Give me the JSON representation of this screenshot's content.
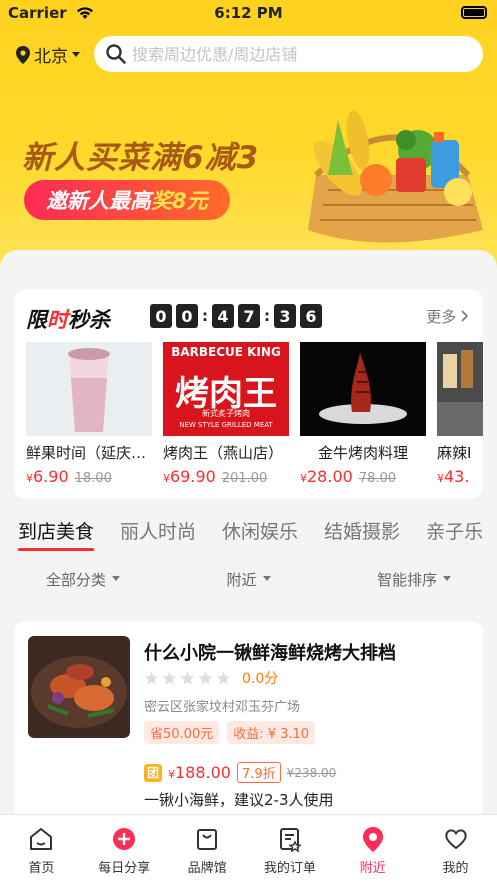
{
  "status_bar": {
    "carrier": "Carrier",
    "time": "6:12 PM"
  },
  "header": {
    "city": "北京",
    "search_placeholder": "搜索周边优惠/周边店铺"
  },
  "banner": {
    "headline": "新人买菜满6减3",
    "pill_prefix": "邀新人最高",
    "pill_highlight": "奖8元"
  },
  "flash_sale": {
    "title_left": "限",
    "title_red": "时",
    "title_right": "秒杀",
    "countdown": [
      "0",
      "0",
      "4",
      "7",
      "3",
      "6"
    ],
    "more_label": "更多",
    "products": [
      {
        "name": "鲜果时间（延庆…",
        "currency": "¥",
        "price": "6.90",
        "old_price": "18.00"
      },
      {
        "name": "烤肉王（燕山店）",
        "currency": "¥",
        "price": "69.90",
        "old_price": "201.00",
        "sign_top": "BARBECUE KING",
        "sign_main": "烤肉王",
        "sign_sub": "新式炙子烤肉",
        "sign_en": "NEW STYLE GRILLED MEAT"
      },
      {
        "name": "金牛烤肉料理",
        "currency": "¥",
        "price": "28.00",
        "old_price": "78.00"
      },
      {
        "name": "麻辣I",
        "currency": "¥",
        "price": "43.",
        "old_price": ""
      }
    ]
  },
  "category_tabs": [
    "到店美食",
    "丽人时尚",
    "休闲娱乐",
    "结婚摄影",
    "亲子乐"
  ],
  "filters": [
    "全部分类",
    "附近",
    "智能排序"
  ],
  "store": {
    "name": "什么小院一锹鲜海鲜烧烤大排档",
    "score": "0.0分",
    "address": "密云区张家坟村邓玉芬广场",
    "tag_save": "省50.00元",
    "tag_income": "收益: ¥ 3.10",
    "deal_badge": "团",
    "deal_currency": "¥",
    "deal_price": "188.00",
    "deal_discount": "7.9折",
    "deal_old": "¥238.00",
    "deal_desc": "一锹小海鲜，建议2-3人使用"
  },
  "tabbar": [
    "首页",
    "每日分享",
    "品牌馆",
    "我的订单",
    "附近",
    "我的"
  ],
  "colors": {
    "brand_yellow": "#ffd21f",
    "accent_red": "#ff2d2d",
    "tab_active": "#ff2d55"
  }
}
